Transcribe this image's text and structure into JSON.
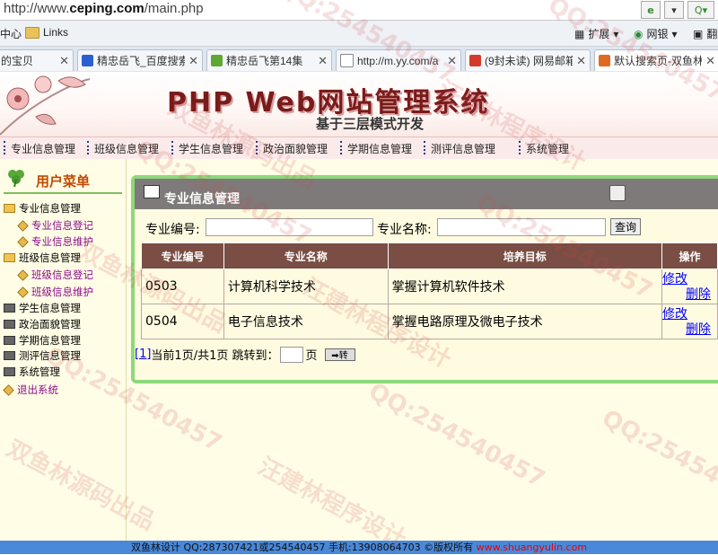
{
  "browser": {
    "url_prefix": "http://www.",
    "url_domain": "ceping.com",
    "url_path": "/main.php",
    "toolbar": {
      "ext_label": "扩展",
      "netbank_label": "网银",
      "more_label": "翻"
    },
    "bookmarks": {
      "first": "中心",
      "links": "Links"
    },
    "tabs": [
      {
        "label": "的宝贝",
        "icon_color": "#d8d8d8"
      },
      {
        "label": "精忠岳飞_百度搜索",
        "icon_color": "#2c5fd0"
      },
      {
        "label": "精忠岳飞第14集",
        "icon_color": "#5ea832"
      },
      {
        "label": "http://m.yy.com/a",
        "icon_color": "#ffffff"
      },
      {
        "label": "(9封未读) 网易邮箱",
        "icon_color": "#d23b2a"
      },
      {
        "label": "默认搜索页-双鱼林",
        "icon_color": "#e06a20"
      }
    ]
  },
  "site": {
    "title": "PHP Web网站管理系统",
    "subtitle": "基于三层模式开发",
    "nav": [
      "专业信息管理",
      "班级信息管理",
      "学生信息管理",
      "政治面貌管理",
      "学期信息管理",
      "测评信息管理",
      "系统管理"
    ]
  },
  "sidebar": {
    "title": "用户菜单",
    "items": [
      {
        "label": "专业信息管理"
      },
      {
        "label": "专业信息登记"
      },
      {
        "label": "专业信息维护"
      },
      {
        "label": "班级信息管理"
      },
      {
        "label": "班级信息登记"
      },
      {
        "label": "班级信息维护"
      },
      {
        "label": "学生信息管理"
      },
      {
        "label": "政治面貌管理"
      },
      {
        "label": "学期信息管理"
      },
      {
        "label": "测评信息管理"
      },
      {
        "label": "系统管理"
      },
      {
        "label": "退出系统"
      }
    ]
  },
  "main": {
    "panel_title": "专业信息管理",
    "search": {
      "code_label": "专业编号:",
      "name_label": "专业名称:",
      "button": "查询",
      "code_value": "",
      "name_value": ""
    },
    "table": {
      "headers": [
        "专业编号",
        "专业名称",
        "培养目标",
        "操作"
      ],
      "rows": [
        {
          "code": "0503",
          "name": "计算机科学技术",
          "goal": "掌握计算机软件技术",
          "edit": "修改",
          "delete": "删除"
        },
        {
          "code": "0504",
          "name": "电子信息技术",
          "goal": "掌握电路原理及微电子技术",
          "edit": "修改",
          "delete": "删除"
        }
      ]
    },
    "pager": {
      "page_link": "[1]",
      "status": "当前1页/共1页 跳转到：",
      "unit": "页",
      "go": "➡转"
    }
  },
  "footer": {
    "text": "双鱼林设计 QQ:287307421或254540457 手机:13908064703 ©版权所有",
    "link": "www.shuangyulin.com"
  },
  "watermark": {
    "qq": "QQ:254540457",
    "t1": "双鱼林源码出品",
    "t2": "汪建林程序设计"
  },
  "colors": {
    "header_brown": "#7a4e44",
    "panel_green": "#8cd97a",
    "footer_blue": "#4a88d9",
    "link": "#0000ff"
  }
}
